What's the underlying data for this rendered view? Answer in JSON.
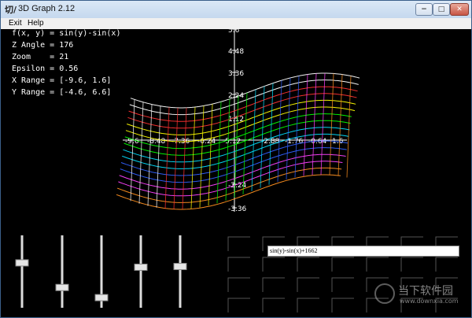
{
  "window": {
    "title": "3D Graph 2.12",
    "app_icon": "切/",
    "buttons": {
      "minimize": "−",
      "maximize": "□",
      "close": "✕"
    }
  },
  "menu": {
    "items": [
      "Exit",
      "Help"
    ]
  },
  "info": {
    "function": "f(x, y) = sin(y)-sin(x)",
    "z_angle": "Z Angle = 176",
    "zoom": "Zoom    = 21",
    "epsilon": "Epsilon = 0.56",
    "x_range": "X Range = [-9.6, 1.6]",
    "y_range": "Y Range = [-4.6, 6.6]"
  },
  "axis": {
    "v_ticks": [
      "5.6",
      "4.48",
      "3.36",
      "2.24",
      "1.12",
      "-2.24",
      "-3.36"
    ],
    "h_ticks": [
      "-9.6",
      "-8.48",
      "-7.36",
      "-6.24",
      "-5.12",
      "-2.88",
      "-1.76",
      "-0.64",
      "1.6"
    ]
  },
  "expression_input": {
    "value": "sin(y)-sin(x)+1662"
  },
  "sliders": [
    {
      "name": "slider-1",
      "level": 0.62
    },
    {
      "name": "slider-2",
      "level": 0.28
    },
    {
      "name": "slider-3",
      "level": 0.14
    },
    {
      "name": "slider-4",
      "level": 0.56
    },
    {
      "name": "slider-5",
      "level": 0.57
    }
  ],
  "watermark": {
    "brand": "当下软件园",
    "url": "www.downxia.com"
  },
  "colors": {
    "surface": [
      "#ffffff",
      "#ff3030",
      "#ffff00",
      "#00ff00",
      "#00e0ff",
      "#3060ff",
      "#ff40ff",
      "#ff9020"
    ]
  }
}
